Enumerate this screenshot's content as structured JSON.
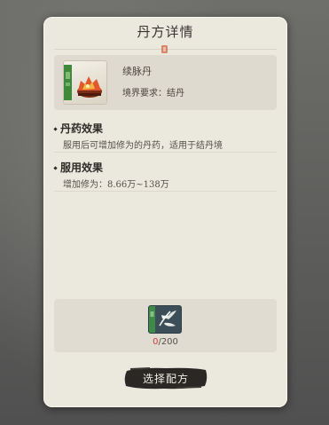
{
  "dialog": {
    "title": "丹方详情"
  },
  "item": {
    "name": "续脉丹",
    "requirement": "境界要求：结丹",
    "icon": "elixir-furnace-icon"
  },
  "sections": [
    {
      "title": "丹药效果",
      "body": "服用后可增加修为的丹药，适用于结丹境"
    },
    {
      "title": "服用效果",
      "body": "增加修为：8.66万~138万"
    }
  ],
  "material": {
    "icon": "herb-scroll-icon",
    "have": "0",
    "need": "/200"
  },
  "button": {
    "label": "选择配方"
  },
  "colors": {
    "panel": "#ebe8de",
    "accent_red": "#c9403a",
    "button_ink": "#2a2724"
  }
}
